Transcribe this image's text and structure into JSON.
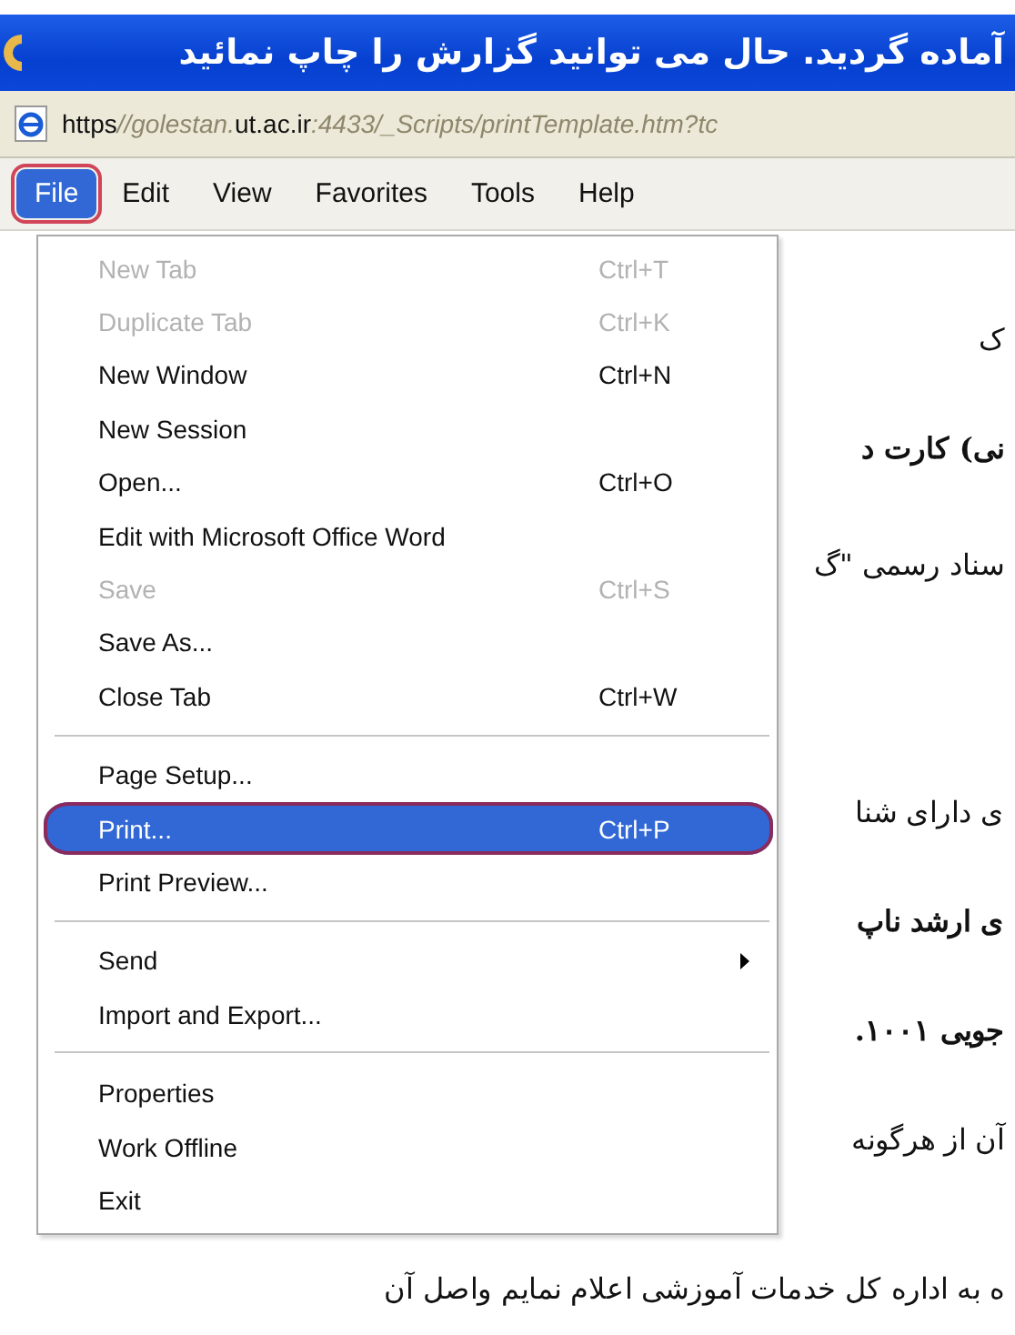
{
  "window": {
    "title": "آماده گردید. حال می توانید گزارش را چاپ نمائید"
  },
  "address_bar": {
    "segments": [
      {
        "text": "https",
        "kind": "strong"
      },
      {
        "text": "//golestan.",
        "kind": "dim"
      },
      {
        "text": "ut.ac.ir",
        "kind": "strong"
      },
      {
        "text": ":4433/_Scripts/printTemplate.htm?tc",
        "kind": "dim"
      }
    ]
  },
  "menu_bar": [
    {
      "label": "File",
      "selected": true,
      "circled": true
    },
    {
      "label": "Edit",
      "selected": false,
      "circled": false
    },
    {
      "label": "View",
      "selected": false,
      "circled": false
    },
    {
      "label": "Favorites",
      "selected": false,
      "circled": false
    },
    {
      "label": "Tools",
      "selected": false,
      "circled": false
    },
    {
      "label": "Help",
      "selected": false,
      "circled": false
    }
  ],
  "file_menu": [
    {
      "kind": "item",
      "label": "New Tab",
      "shortcut": "Ctrl+T",
      "disabled": true,
      "selected": false,
      "circled": false,
      "submenu": false
    },
    {
      "kind": "item",
      "label": "Duplicate Tab",
      "shortcut": "Ctrl+K",
      "disabled": true,
      "selected": false,
      "circled": false,
      "submenu": false
    },
    {
      "kind": "item",
      "label": "New Window",
      "shortcut": "Ctrl+N",
      "disabled": false,
      "selected": false,
      "circled": false,
      "submenu": false
    },
    {
      "kind": "item",
      "label": "New Session",
      "disabled": false,
      "selected": false,
      "circled": false,
      "submenu": false
    },
    {
      "kind": "item",
      "label": "Open...",
      "shortcut": "Ctrl+O",
      "disabled": false,
      "selected": false,
      "circled": false,
      "submenu": false
    },
    {
      "kind": "item",
      "label": "Edit with Microsoft Office Word",
      "disabled": false,
      "selected": false,
      "circled": false,
      "submenu": false
    },
    {
      "kind": "item",
      "label": "Save",
      "shortcut": "Ctrl+S",
      "disabled": true,
      "selected": false,
      "circled": false,
      "submenu": false
    },
    {
      "kind": "item",
      "label": "Save As...",
      "disabled": false,
      "selected": false,
      "circled": false,
      "submenu": false
    },
    {
      "kind": "item",
      "label": "Close Tab",
      "shortcut": "Ctrl+W",
      "disabled": false,
      "selected": false,
      "circled": false,
      "submenu": false
    },
    {
      "kind": "separator"
    },
    {
      "kind": "item",
      "label": "Page Setup...",
      "disabled": false,
      "selected": false,
      "circled": false,
      "submenu": false
    },
    {
      "kind": "item",
      "label": "Print...",
      "shortcut": "Ctrl+P",
      "disabled": false,
      "selected": true,
      "circled": true,
      "submenu": false
    },
    {
      "kind": "item",
      "label": "Print Preview...",
      "disabled": false,
      "selected": false,
      "circled": false,
      "submenu": false
    },
    {
      "kind": "separator"
    },
    {
      "kind": "item",
      "label": "Send",
      "disabled": false,
      "selected": false,
      "circled": false,
      "submenu": true
    },
    {
      "kind": "item",
      "label": "Import and Export...",
      "disabled": false,
      "selected": false,
      "circled": false,
      "submenu": false
    },
    {
      "kind": "separator"
    },
    {
      "kind": "item",
      "label": "Properties",
      "disabled": false,
      "selected": false,
      "circled": false,
      "submenu": false
    },
    {
      "kind": "item",
      "label": "Work Offline",
      "disabled": false,
      "selected": false,
      "circled": false,
      "submenu": false
    },
    {
      "kind": "item",
      "label": "Exit",
      "disabled": false,
      "selected": false,
      "circled": false,
      "submenu": false
    }
  ],
  "page_lines": [
    {
      "text": "ک",
      "bold": false
    },
    {
      "text": "نی) کارت د",
      "bold": true
    },
    {
      "text": "سناد رسمی \"گ",
      "bold": false
    },
    {
      "text": "ی دارای شنا",
      "bold": false
    },
    {
      "text": "ی ارشد ناپ",
      "bold": true
    },
    {
      "text": "جویی ۱۰۰۱.",
      "bold": true
    },
    {
      "text": "آن از هرگونه",
      "bold": false
    }
  ],
  "footer_line": {
    "text": "ه به اداره کل خدمات آموزشی اعلام نمایم واصل آن",
    "bold": false
  }
}
